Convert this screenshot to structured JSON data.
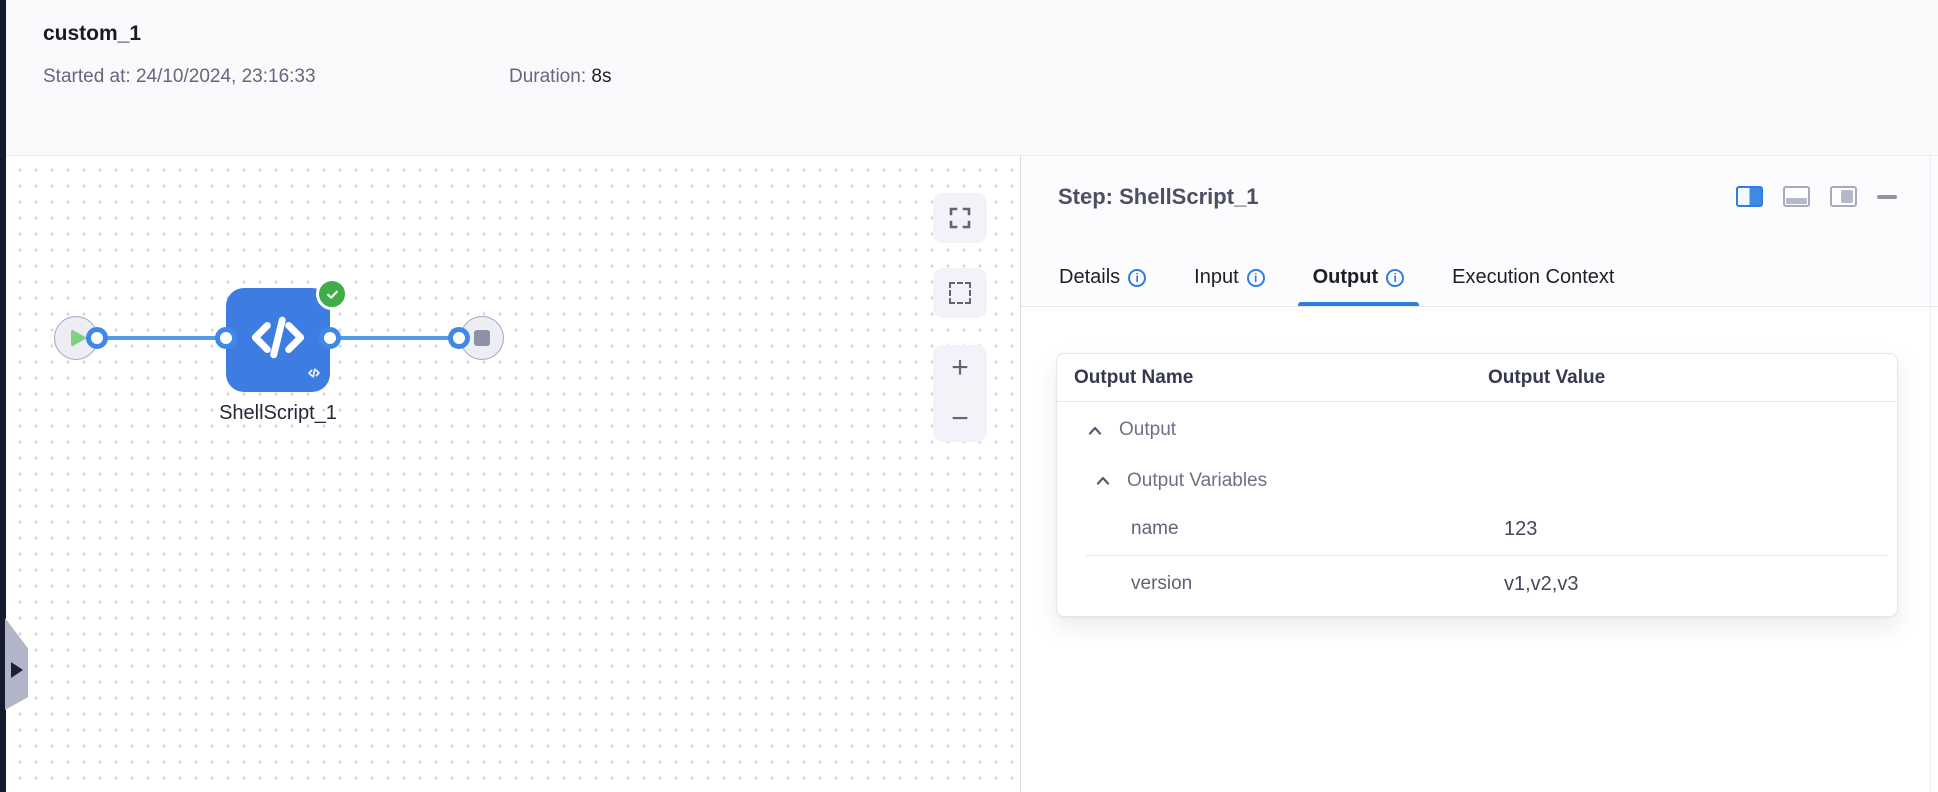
{
  "header": {
    "title": "custom_1",
    "started_label": "Started at:",
    "started_value": "24/10/2024, 23:16:33",
    "duration_label": "Duration:",
    "duration_value": "8s"
  },
  "canvas": {
    "node_label": "ShellScript_1",
    "node_status": "success"
  },
  "panel": {
    "title": "Step: ShellScript_1",
    "tabs": [
      {
        "label": "Details",
        "has_info": true,
        "active": false
      },
      {
        "label": "Input",
        "has_info": true,
        "active": false
      },
      {
        "label": "Output",
        "has_info": true,
        "active": true
      },
      {
        "label": "Execution Context",
        "has_info": false,
        "active": false
      }
    ],
    "table": {
      "col_name": "Output Name",
      "col_value": "Output Value",
      "rows": [
        {
          "name": "Output",
          "value": "",
          "type": "group",
          "level": 0
        },
        {
          "name": "Output Variables",
          "value": "",
          "type": "group",
          "level": 1
        },
        {
          "name": "name",
          "value": "123",
          "type": "leaf",
          "level": 2
        },
        {
          "name": "version",
          "value": "v1,v2,v3",
          "type": "leaf",
          "level": 2
        }
      ]
    }
  },
  "icons": {
    "info_glyph": "i",
    "zoom_in_glyph": "+",
    "zoom_out_glyph": "−"
  },
  "colors": {
    "accent_blue": "#2e7de2",
    "node_blue": "#3d7de2",
    "edge_blue": "#4f9ce9",
    "success_green": "#43ac4a",
    "play_green": "#7fd07f",
    "left_strip": "#161a2d"
  }
}
